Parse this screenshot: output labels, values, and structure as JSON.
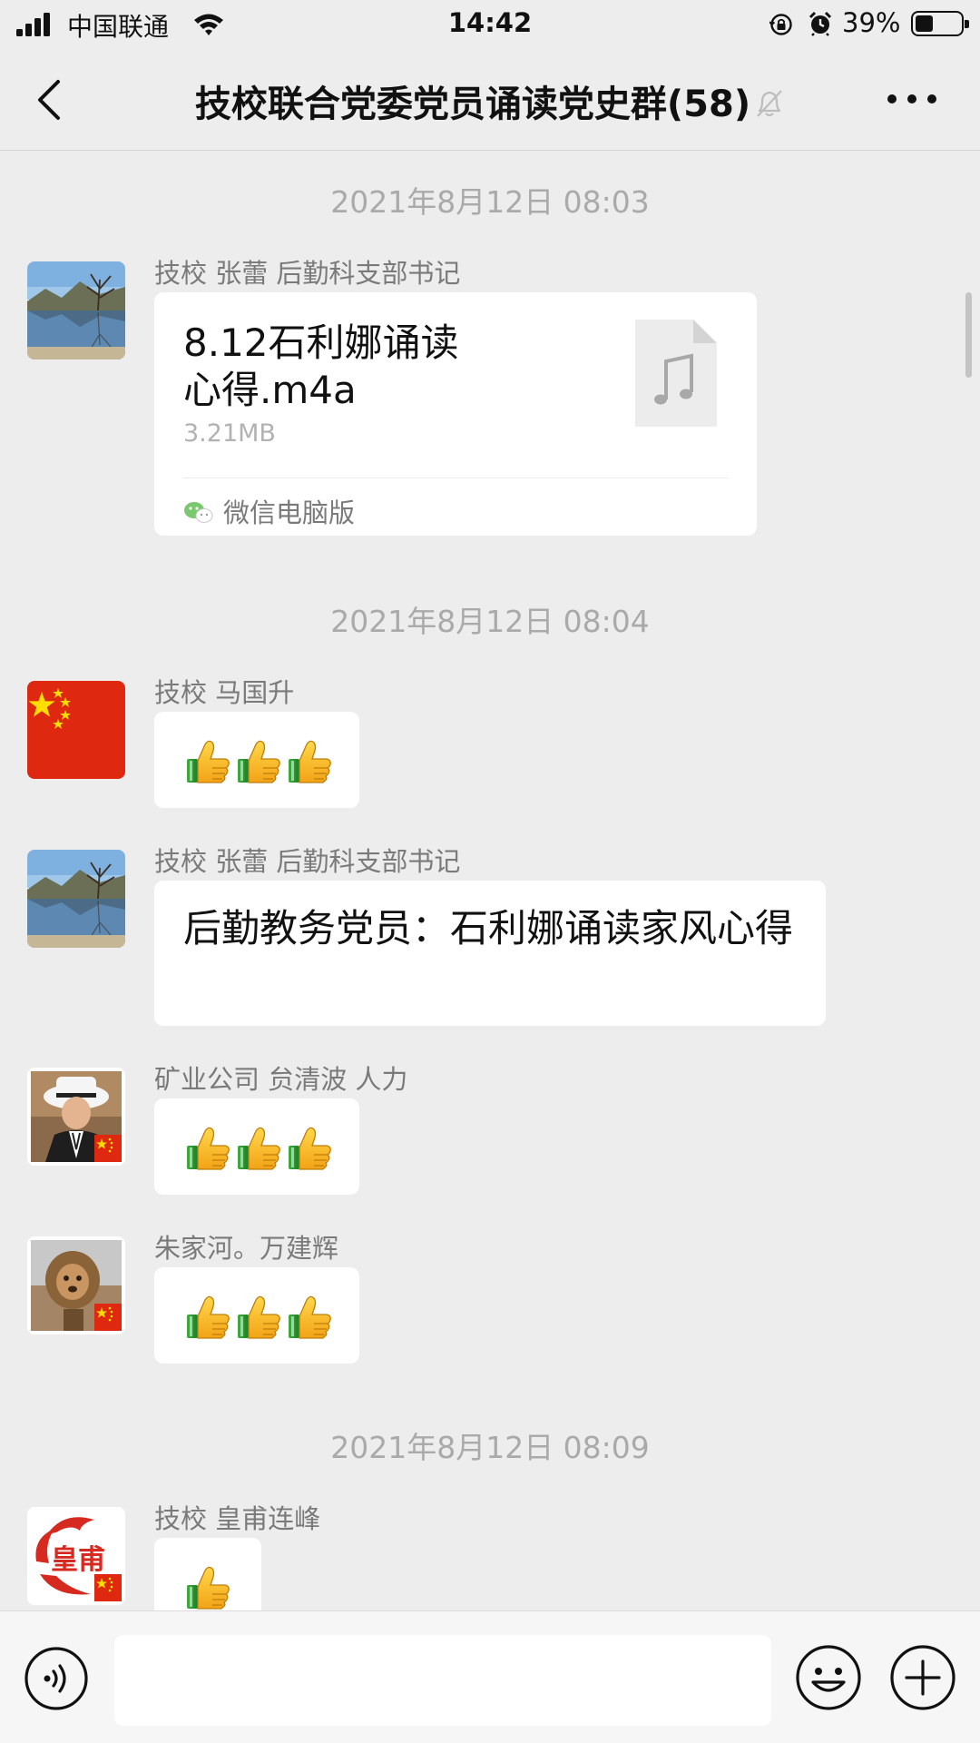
{
  "status_bar": {
    "carrier": "中国联通",
    "time": "14:42",
    "battery_percent": "39%",
    "battery_level": 0.39
  },
  "header": {
    "title": "技校联合党委党员诵读党史群(58)",
    "muted": true
  },
  "messages": [
    {
      "type": "timestamp",
      "text": "2021年8月12日 08:03"
    },
    {
      "type": "file",
      "sender": "技校  张蕾 后勤科支部书记",
      "file_name": "8.12石利娜诵读心得.m4a",
      "file_size": "3.21MB",
      "source": "微信电脑版",
      "icon": "music-note-icon"
    },
    {
      "type": "timestamp",
      "text": "2021年8月12日 08:04"
    },
    {
      "type": "emoji",
      "sender": "技校 马国升",
      "content": "thumbs-up x3"
    },
    {
      "type": "text",
      "sender": "技校  张蕾 后勤科支部书记",
      "text": "后勤教务党员：石利娜诵读家风心得"
    },
    {
      "type": "emoji",
      "sender": "矿业公司 贠清波 人力",
      "content": "thumbs-up x3"
    },
    {
      "type": "emoji",
      "sender": "朱家河。万建辉",
      "content": "thumbs-up x3"
    },
    {
      "type": "timestamp",
      "text": "2021年8月12日 08:09"
    },
    {
      "type": "emoji",
      "sender": "技校 皇甫连峰",
      "content": "thumbs-up x1"
    }
  ],
  "avatar_logo_text": "皇甫",
  "input_bar": {
    "value": "",
    "icons": [
      "voice-icon",
      "emoji-icon",
      "plus-icon"
    ]
  },
  "colors": {
    "background": "#ededed",
    "bubble": "#ffffff",
    "timestamp": "#aaaaaa",
    "sender": "#7a7a7a",
    "flag_red": "#de2910",
    "flag_yellow": "#ffde00"
  }
}
